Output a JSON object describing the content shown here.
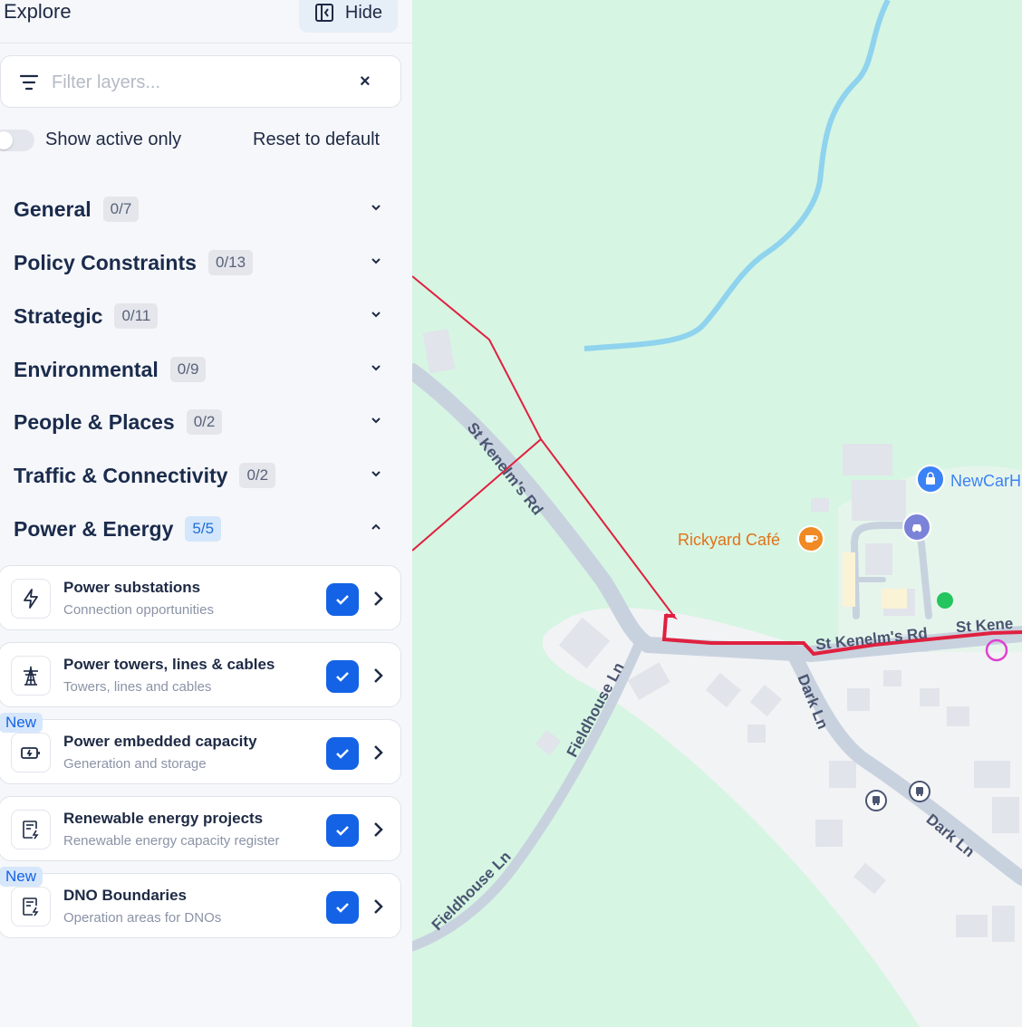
{
  "sidebar": {
    "title": "Explore",
    "hide_label": "Hide",
    "filter_placeholder": "Filter layers...",
    "clear_label": "×",
    "show_active_label": "Show active only",
    "reset_label": "Reset to default",
    "categories": [
      {
        "name": "General",
        "count": "0/7"
      },
      {
        "name": "Policy Constraints",
        "count": "0/13"
      },
      {
        "name": "Strategic",
        "count": "0/11"
      },
      {
        "name": "Environmental",
        "count": "0/9"
      },
      {
        "name": "People & Places",
        "count": "0/2"
      },
      {
        "name": "Traffic & Connectivity",
        "count": "0/2"
      },
      {
        "name": "Power & Energy",
        "count": "5/5"
      }
    ],
    "layers": [
      {
        "title": "Power substations",
        "subtitle": "Connection opportunities",
        "icon": "lightning-icon"
      },
      {
        "title": "Power towers, lines & cables",
        "subtitle": "Towers, lines and cables",
        "icon": "pylon-icon"
      },
      {
        "title": "Power embedded capacity",
        "subtitle": "Generation and storage",
        "icon": "battery-icon",
        "tag": "New"
      },
      {
        "title": "Renewable energy projects",
        "subtitle": "Renewable energy capacity register",
        "icon": "register-icon"
      },
      {
        "title": "DNO Boundaries",
        "subtitle": "Operation areas for DNOs",
        "icon": "register-icon",
        "tag": "New"
      }
    ]
  },
  "map": {
    "roads": {
      "st_kenelms_rd_1": "St Kenelm's Rd",
      "st_kenelms_rd_2": "St Kenelm's Rd",
      "st_kenelms_rd_3": "St Kene",
      "fieldhouse_ln_1": "Fieldhouse Ln",
      "fieldhouse_ln_2": "Fieldhouse Ln",
      "dark_ln_1": "Dark Ln",
      "dark_ln_2": "Dark Ln"
    },
    "pois": {
      "cafe": "Rickyard Café",
      "newcar": "NewCarH"
    },
    "colors": {
      "land": "#d6f5e3",
      "river": "#8fd3ee",
      "road": "#c8d2df",
      "builtup": "#f3f4f6",
      "boundary": "#e0203f",
      "cafe": "#f08a24",
      "poi_blue": "#3b82f6"
    }
  }
}
